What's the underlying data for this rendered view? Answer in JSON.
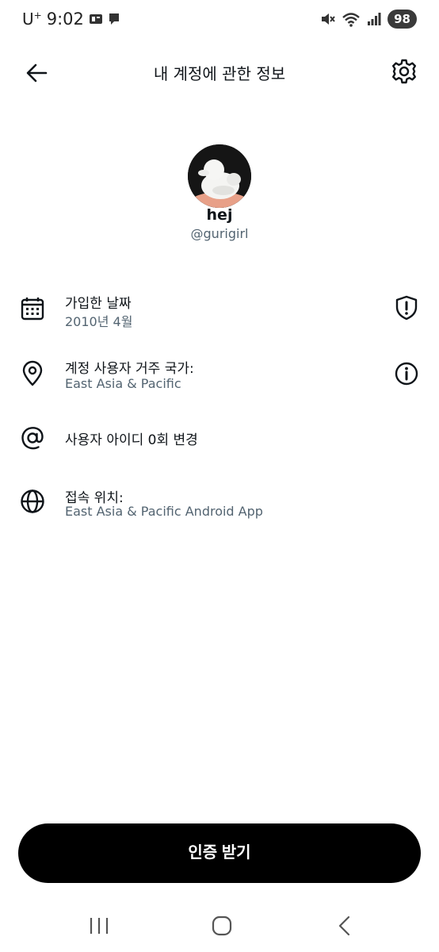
{
  "status_bar": {
    "carrier": "U",
    "carrier_sup": "+",
    "time": "9:02",
    "battery": "98"
  },
  "header": {
    "title": "내 계정에 관한 정보"
  },
  "profile": {
    "display_name": "hej",
    "handle": "@gurigirl"
  },
  "info_rows": [
    {
      "title": "가입한 날짜",
      "subtitle": "2010년 4월",
      "icon": "calendar-icon",
      "action_icon": "shield-icon"
    },
    {
      "title": "계정 사용자 거주 국가:",
      "subtitle": "East Asia & Pacific",
      "icon": "location-pin-icon",
      "action_icon": "info-icon"
    },
    {
      "title": "사용자 아이디 0회 변경",
      "icon": "at-sign-icon"
    },
    {
      "title": "접속 위치:",
      "subtitle": "East Asia & Pacific Android App",
      "icon": "globe-icon"
    }
  ],
  "verify_button": {
    "label": "인증 받기"
  },
  "colors": {
    "primary_text": "#0f1419",
    "secondary_text": "#536471",
    "button_bg": "#000000"
  }
}
